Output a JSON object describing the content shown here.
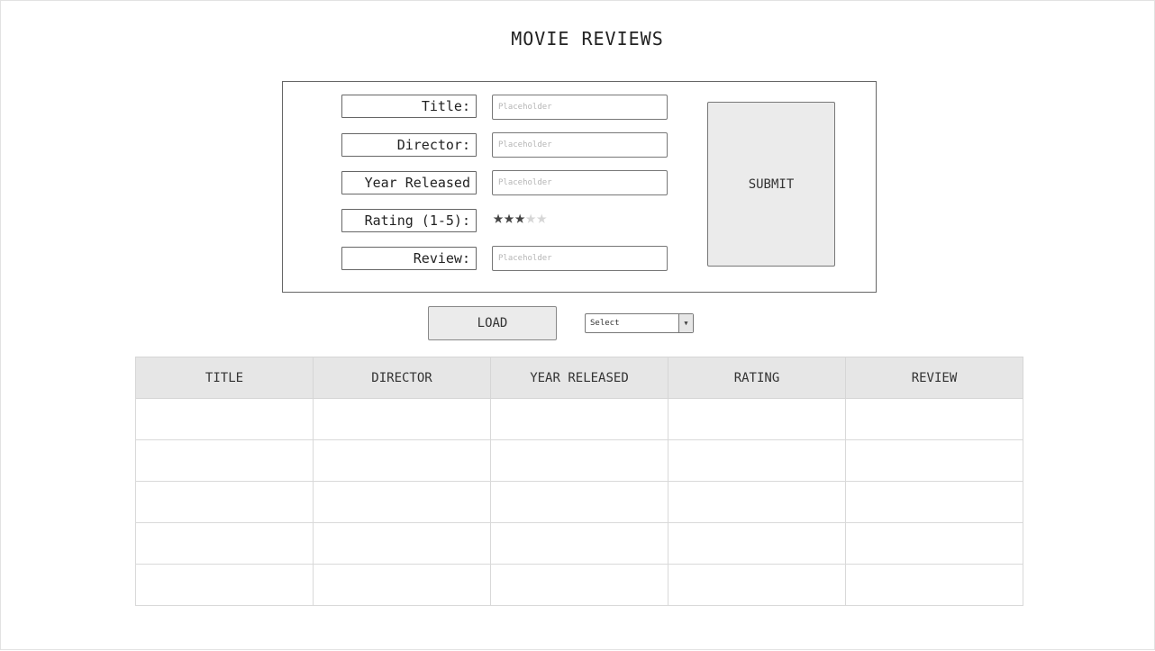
{
  "page": {
    "title": "MOVIE REVIEWS"
  },
  "form": {
    "fields": [
      {
        "label": "Title:",
        "placeholder": "Placeholder",
        "value": ""
      },
      {
        "label": "Director:",
        "placeholder": "Placeholder",
        "value": ""
      },
      {
        "label": "Year Released",
        "placeholder": "Placeholder",
        "value": ""
      },
      {
        "label": "Rating (1-5):"
      },
      {
        "label": "Review:",
        "placeholder": "Placeholder",
        "value": ""
      }
    ],
    "rating": {
      "value": 3,
      "max": 5,
      "star_glyph": "★"
    },
    "submit_label": "SUBMIT"
  },
  "controls": {
    "load_label": "LOAD",
    "select_value": "Select",
    "select_arrow_icon": "caret-down-icon"
  },
  "table": {
    "columns": [
      "TITLE",
      "DIRECTOR",
      "YEAR RELEASED",
      "RATING",
      "REVIEW"
    ],
    "rows": [
      [
        "",
        "",
        "",
        "",
        ""
      ],
      [
        "",
        "",
        "",
        "",
        ""
      ],
      [
        "",
        "",
        "",
        "",
        ""
      ],
      [
        "",
        "",
        "",
        "",
        ""
      ],
      [
        "",
        "",
        "",
        "",
        ""
      ]
    ]
  },
  "colors": {
    "star_on": "#444444",
    "star_off": "#d6d6d6",
    "header_bg": "#e6e6e6",
    "button_bg": "#ebebeb"
  }
}
